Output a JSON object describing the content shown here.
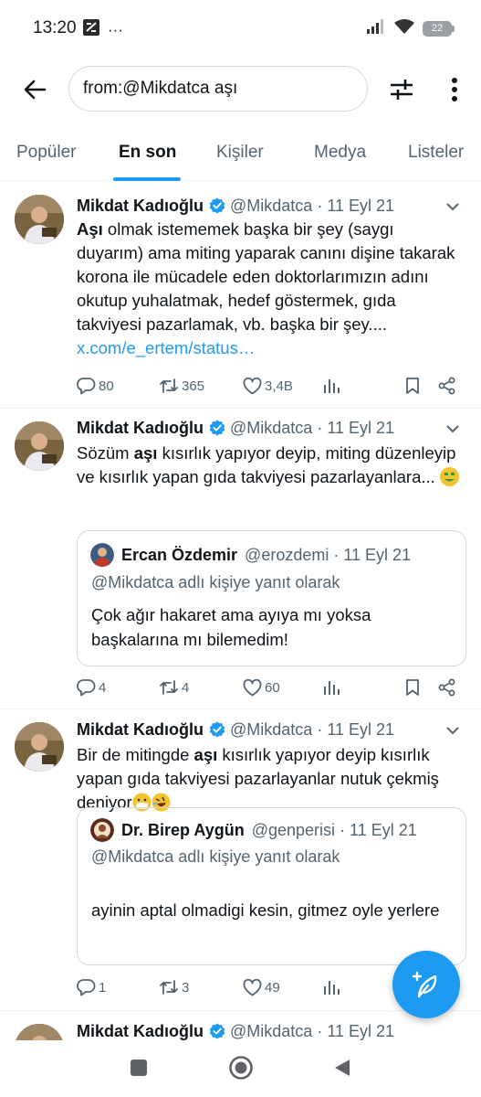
{
  "status_bar": {
    "time": "13:20",
    "ellipsis": "···",
    "battery": "22"
  },
  "search": {
    "query": "from:@Mikdatca aşı"
  },
  "tabs": [
    {
      "label": "Popüler"
    },
    {
      "label": "En son",
      "active": true
    },
    {
      "label": "Kişiler"
    },
    {
      "label": "Medya"
    },
    {
      "label": "Listeler"
    }
  ],
  "accent_color": "#1d9bf0",
  "tweets": [
    {
      "name": "Mikdat Kadıoğlu",
      "handle": "@Mikdatca",
      "dot": "·",
      "date": "11 Eyl 21",
      "body_bold": "Aşı",
      "body": " olmak istememek başka bir şey (saygı duyarım) ama miting yaparak canını dişine takarak korona ile mücadele eden doktorlarımızın adını okutup yuhalatmak, hedef göstermek, gıda takviyesi pazarlamak, vb. başka bir şey.... ",
      "link": "x.com/e_ertem/status…",
      "replies": "80",
      "retweets": "365",
      "likes": "3,4B"
    },
    {
      "name": "Mikdat Kadıoğlu",
      "handle": "@Mikdatca",
      "dot": "·",
      "date": "11 Eyl 21",
      "body_pre": "Sözüm ",
      "body_bold": "aşı",
      "body": " kısırlık yapıyor deyip, miting düzenleyip  ve kısırlık yapan gıda takviyesi pazarlayanlara... ",
      "emoji": "money-mouth-face",
      "quote": {
        "name": "Ercan Özdemir",
        "handle": "@erozdemi",
        "dot": "·",
        "date": "11 Eyl 21",
        "reply_to": "@Mikdatca adlı kişiye yanıt olarak",
        "text": "Çok ağır hakaret ama ayıya mı yoksa başkalarına mı bilemedim!"
      },
      "replies": "4",
      "retweets": "4",
      "likes": "60"
    },
    {
      "name": "Mikdat Kadıoğlu",
      "handle": "@Mikdatca",
      "dot": "·",
      "date": "11 Eyl 21",
      "body_pre": "Bir de mitingde ",
      "body_bold": "aşı",
      "body": " kısırlık yapıyor deyip kısırlık yapan gıda takviyesi pazarlayanlar nutuk çekmiş deniyor",
      "emojis": [
        "face-with-medical-mask",
        "rolling-on-the-floor-laughing"
      ],
      "quote": {
        "name": "Dr. Birep Aygün",
        "handle": "@genperisi",
        "dot": "·",
        "date": "11 Eyl 21",
        "reply_to": "@Mikdatca adlı kişiye yanıt olarak",
        "text": "ayinin aptal olmadigi kesin, gitmez oyle yerlere"
      },
      "replies": "1",
      "retweets": "3",
      "likes": "49"
    },
    {
      "name": "Mikdat Kadıoğlu",
      "handle": "@Mikdatca",
      "dot": "·",
      "date": "11 Eyl 21"
    }
  ],
  "icons": {
    "back": "arrow-left-icon",
    "filter": "sliders-icon",
    "more": "more-vertical-icon",
    "verified": "verified-badge-icon",
    "reply": "reply-icon",
    "retweet": "retweet-icon",
    "like": "heart-icon",
    "views": "views-icon",
    "bookmark": "bookmark-icon",
    "share": "share-icon",
    "compose": "compose-feather-icon"
  }
}
